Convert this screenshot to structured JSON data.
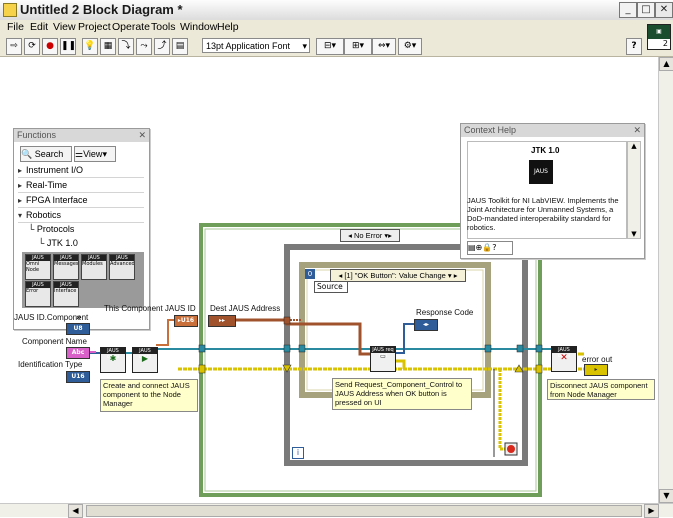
{
  "window": {
    "title": "Untitled 2 Block Diagram *",
    "minimize": "_",
    "maximize": "□",
    "close": "✕"
  },
  "menu": [
    "File",
    "Edit",
    "View",
    "Project",
    "Operate",
    "Tools",
    "Window",
    "Help"
  ],
  "toolbar": {
    "font_select": "13pt Application Font",
    "vi_icon_number": "2",
    "help_button": "?"
  },
  "functions_palette": {
    "title": "Functions",
    "search_label": "Search",
    "view_label": "View",
    "categories": [
      "Instrument I/O",
      "Real-Time",
      "FPGA Interface",
      "Robotics"
    ],
    "subitems": [
      "Protocols",
      "JTK 1.0"
    ],
    "icons": [
      {
        "header": "JAUS",
        "label": "Omni Node"
      },
      {
        "header": "JAUS",
        "label": "Messages"
      },
      {
        "header": "JAUS",
        "label": "Modules"
      },
      {
        "header": "JAUS",
        "label": "Advanced"
      },
      {
        "header": "JAUS",
        "label": "Error"
      },
      {
        "header": "JAUS",
        "label": "Interface"
      }
    ],
    "more": "»"
  },
  "context_help": {
    "title": "Context Help",
    "heading": "JTK 1.0",
    "icon_text": "JAUS",
    "description": "JAUS Toolkit for NI LabVIEW. Implements the Joint Architecture for Unmanned Systems, a DoD-mandated interoperability standard for robotics."
  },
  "diagram": {
    "case_selector": "No Error",
    "event_selector": "[1] \"OK Button\": Value Change",
    "event_source": "Source",
    "event_index": "0",
    "controls": {
      "jaus_id_label": "JAUS ID.Component",
      "jaus_id_type": "U8",
      "component_name_label": "Component Name",
      "component_name_type": "Abc",
      "identification_type_label": "Identification Type",
      "identification_type_type": "U16"
    },
    "this_component_label": "This Component JAUS ID",
    "dest_address_label": "Dest JAUS Address",
    "response_code_label": "Response Code",
    "error_out_label": "error out",
    "comments": [
      "Create and connect JAUS component to the Node Manager",
      "Send Request_Component_Control to JAUS Address when OK button is pressed on UI",
      "Disconnect JAUS component from Node Manager"
    ],
    "vi_texts": [
      "JAUS omni",
      "JAUS omni",
      "JAUS req ctrl",
      "JAUS omni"
    ],
    "iteration_icon": "i"
  },
  "colors": {
    "case_border": "#6e9e5a",
    "while_border": "#7a7a7a",
    "event_border": "#a6a27d",
    "error_wire": "#d9c200",
    "blue_wire": "#2e5d9a",
    "orange_wire": "#c9703a",
    "teal_wire": "#2a8aa0"
  }
}
